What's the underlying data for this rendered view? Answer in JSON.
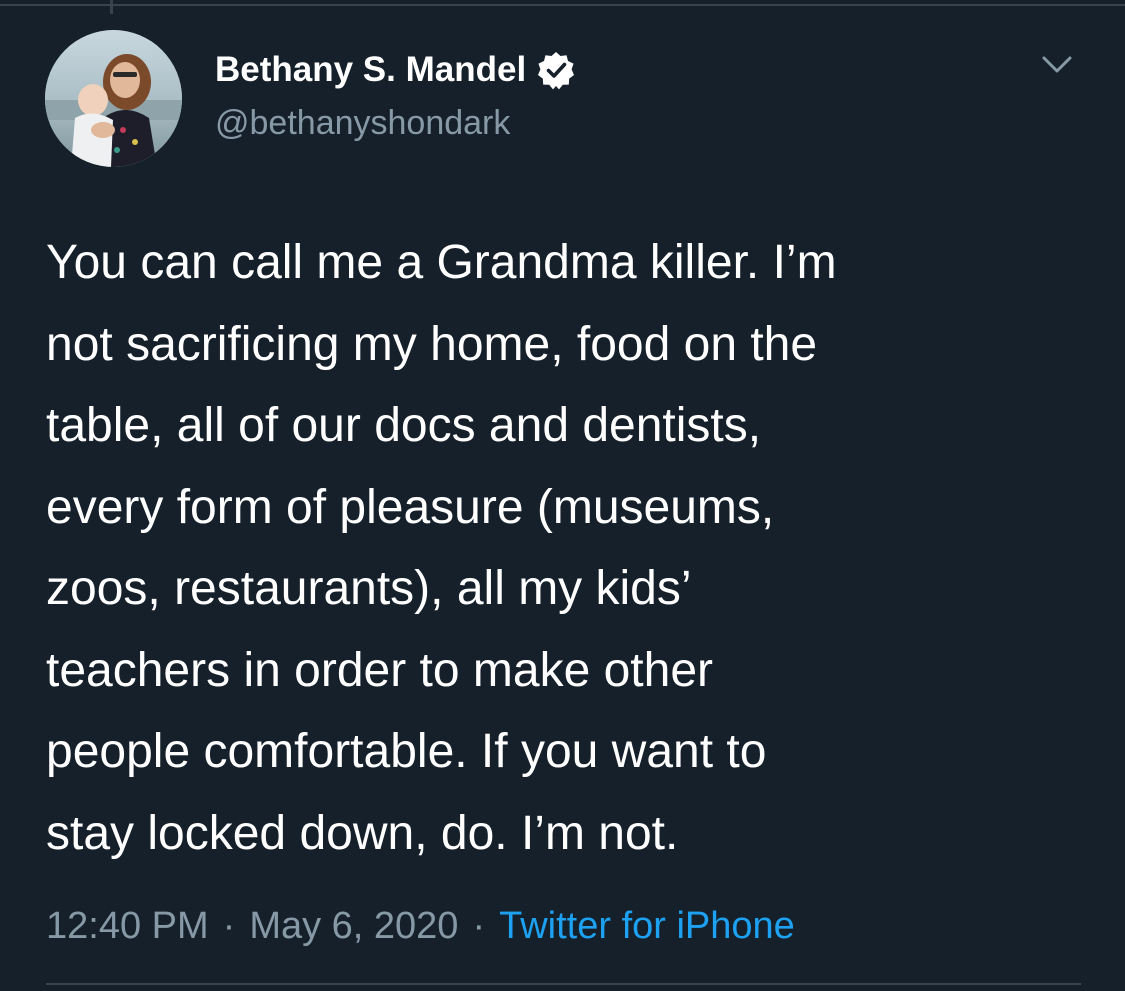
{
  "tweet": {
    "author": {
      "display_name": "Bethany S. Mandel",
      "handle": "@bethanyshondark",
      "verified": true,
      "avatar_icon": "user-avatar-photo"
    },
    "menu_icon": "chevron-down-icon",
    "text_lines": [
      "You can call me a Grandma killer. I’m",
      "not sacrificing my home, food on the",
      "table, all of our docs and dentists,",
      "every form of pleasure (museums,",
      "zoos, restaurants), all my kids’",
      "teachers in order to make other",
      "people comfortable. If you want to",
      "stay locked down, do. I’m not."
    ],
    "time": "12:40 PM",
    "separator": "·",
    "date": "May 6, 2020",
    "source": "Twitter for iPhone"
  },
  "colors": {
    "background": "#15202b",
    "text_primary": "#ffffff",
    "text_secondary": "#8899a6",
    "link": "#1da1f2",
    "divider": "#38444d"
  }
}
